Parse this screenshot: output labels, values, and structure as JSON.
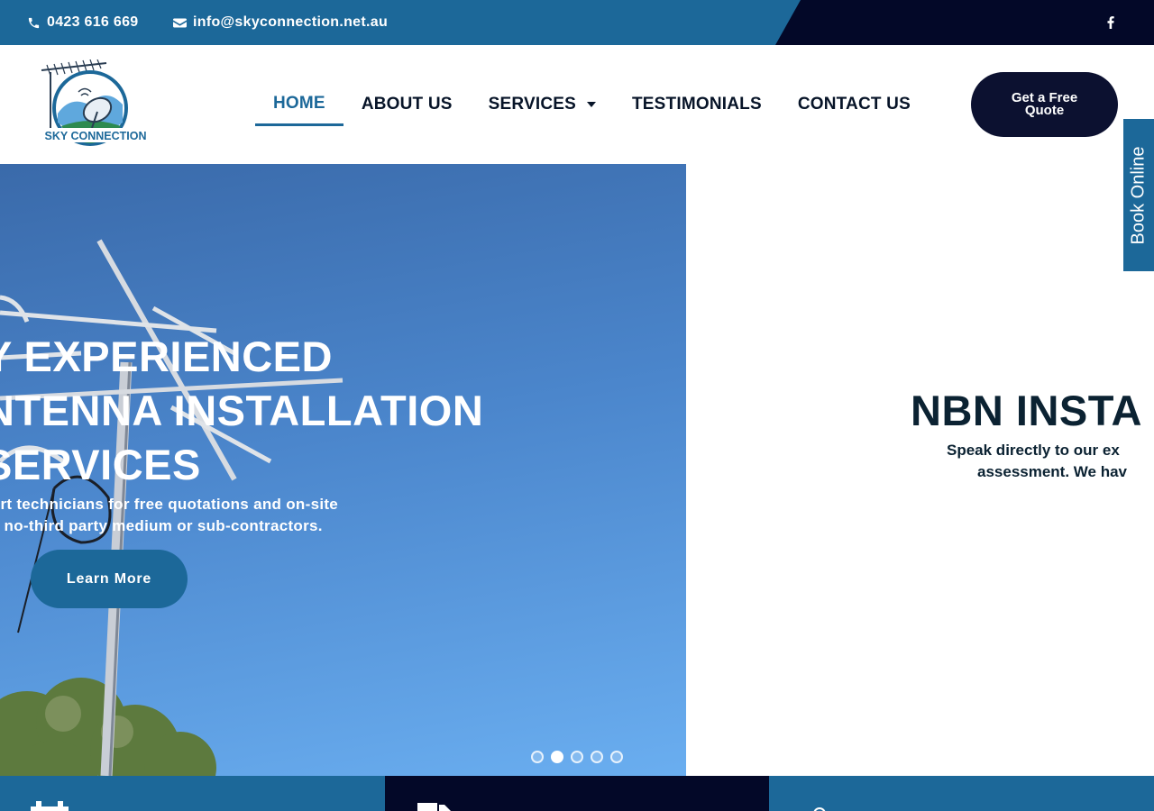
{
  "topbar": {
    "phone": "0423 616 669",
    "email": "info@skyconnection.net.au",
    "social": [
      "facebook-icon"
    ]
  },
  "brand": {
    "logo_text": "SKY CONNECTION"
  },
  "nav": {
    "items": [
      {
        "label": "HOME",
        "active": true
      },
      {
        "label": "ABOUT US"
      },
      {
        "label": "SERVICES",
        "has_dropdown": true
      },
      {
        "label": "TESTIMONIALS"
      },
      {
        "label": "CONTACT US"
      }
    ],
    "cta": "Get a Free Quote"
  },
  "book_tab": "Book Online",
  "hero": {
    "slide1": {
      "title_lines": [
        "Y EXPERIENCED",
        "NTENNA INSTALLATION",
        "SERVICES"
      ],
      "sub_lines": [
        "pert technicians for free quotations and on-site",
        "ve no-third party medium or sub-contractors."
      ],
      "button": "Learn More"
    },
    "slide2": {
      "title": "NBN INSTA",
      "sub_lines": [
        "Speak directly to our ex",
        "assessment. We hav"
      ]
    },
    "dots": {
      "count": 5,
      "active_index": 1
    }
  },
  "colors": {
    "primary": "#1c6899",
    "dark": "#030828",
    "button_dark": "#0c1130"
  },
  "icons": [
    "phone-icon",
    "envelope-icon",
    "facebook-icon",
    "calendar-icon",
    "truck-icon",
    "map-pin-icon"
  ]
}
